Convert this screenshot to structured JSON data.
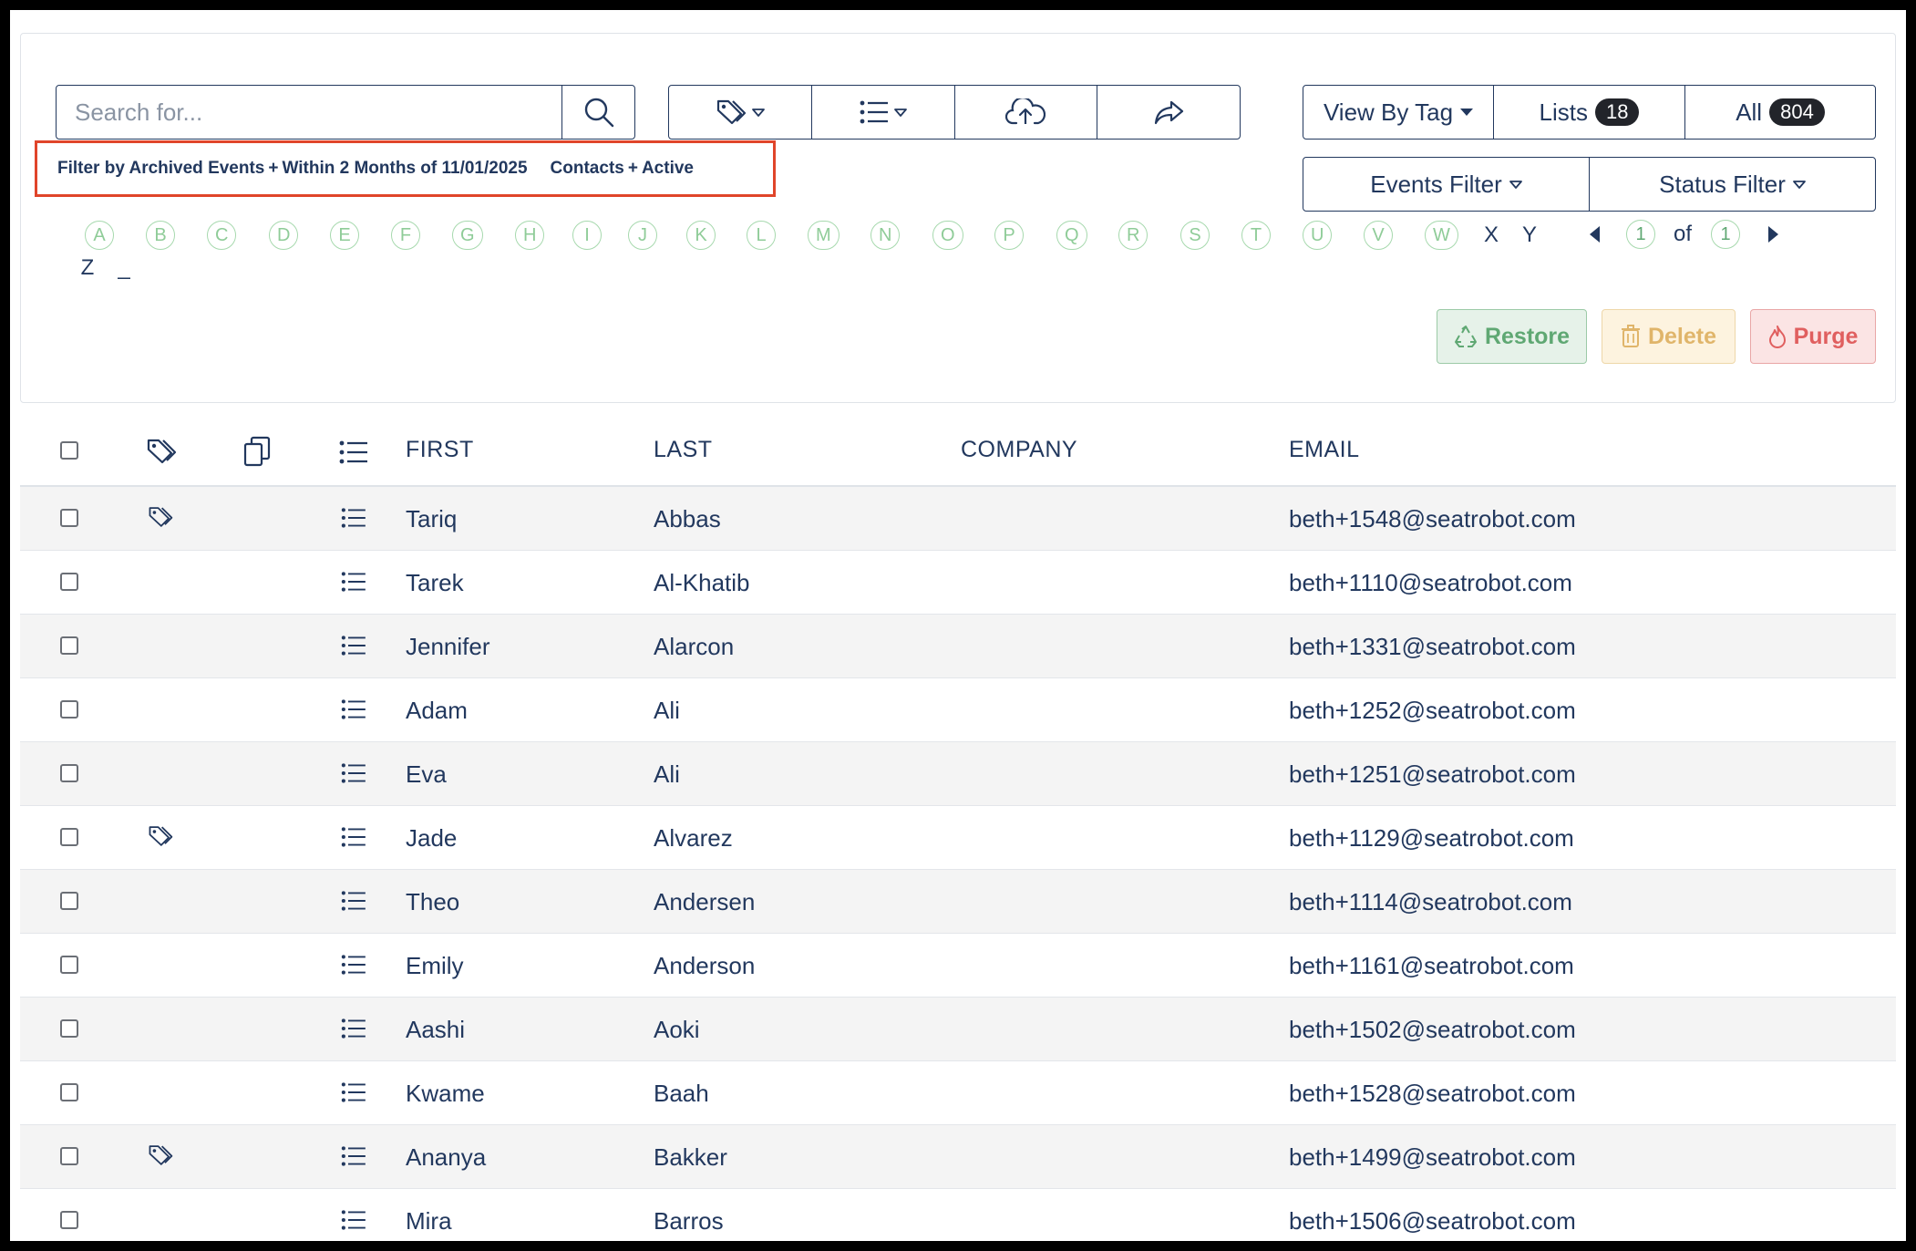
{
  "search": {
    "placeholder": "Search for..."
  },
  "toolbar": {
    "tag_icon": "tag-icon",
    "list_icon": "list-icon",
    "upload_icon": "cloud-upload-icon",
    "share_icon": "share-icon"
  },
  "view": {
    "by_tag_label": "View By Tag",
    "lists_label": "Lists",
    "lists_count": "18",
    "all_label": "All",
    "all_count": "804"
  },
  "filters": {
    "events_label": "Events Filter",
    "status_label": "Status Filter",
    "active_filter": {
      "part1": "Filter by Archived Events",
      "part2": "Within 2 Months of 11/01/2025",
      "part3": "Contacts",
      "part4": "Active"
    }
  },
  "letters": [
    "A",
    "B",
    "C",
    "D",
    "E",
    "F",
    "G",
    "H",
    "I",
    "J",
    "K",
    "L",
    "M",
    "N",
    "O",
    "P",
    "Q",
    "R",
    "S",
    "T",
    "U",
    "V",
    "W"
  ],
  "plain_letters": [
    "X",
    "Y",
    "Z",
    "_"
  ],
  "pager": {
    "current": "1",
    "of_label": "of",
    "total": "1"
  },
  "actions": {
    "restore": "Restore",
    "delete": "Delete",
    "purge": "Purge"
  },
  "table": {
    "headers": {
      "first": "FIRST",
      "last": "LAST",
      "company": "COMPANY",
      "email": "EMAIL"
    },
    "rows": [
      {
        "first": "Tariq",
        "last": "Abbas",
        "company": "",
        "email": "beth+1548@seatrobot.com",
        "tagged": true
      },
      {
        "first": "Tarek",
        "last": "Al-Khatib",
        "company": "",
        "email": "beth+1110@seatrobot.com",
        "tagged": false
      },
      {
        "first": "Jennifer",
        "last": "Alarcon",
        "company": "",
        "email": "beth+1331@seatrobot.com",
        "tagged": false
      },
      {
        "first": "Adam",
        "last": "Ali",
        "company": "",
        "email": "beth+1252@seatrobot.com",
        "tagged": false
      },
      {
        "first": "Eva",
        "last": "Ali",
        "company": "",
        "email": "beth+1251@seatrobot.com",
        "tagged": false
      },
      {
        "first": "Jade",
        "last": "Alvarez",
        "company": "",
        "email": "beth+1129@seatrobot.com",
        "tagged": true
      },
      {
        "first": "Theo",
        "last": "Andersen",
        "company": "",
        "email": "beth+1114@seatrobot.com",
        "tagged": false
      },
      {
        "first": "Emily",
        "last": "Anderson",
        "company": "",
        "email": "beth+1161@seatrobot.com",
        "tagged": false
      },
      {
        "first": "Aashi",
        "last": "Aoki",
        "company": "",
        "email": "beth+1502@seatrobot.com",
        "tagged": false
      },
      {
        "first": "Kwame",
        "last": "Baah",
        "company": "",
        "email": "beth+1528@seatrobot.com",
        "tagged": false
      },
      {
        "first": "Ananya",
        "last": "Bakker",
        "company": "",
        "email": "beth+1499@seatrobot.com",
        "tagged": true
      },
      {
        "first": "Mira",
        "last": "Barros",
        "company": "",
        "email": "beth+1506@seatrobot.com",
        "tagged": false
      }
    ]
  }
}
